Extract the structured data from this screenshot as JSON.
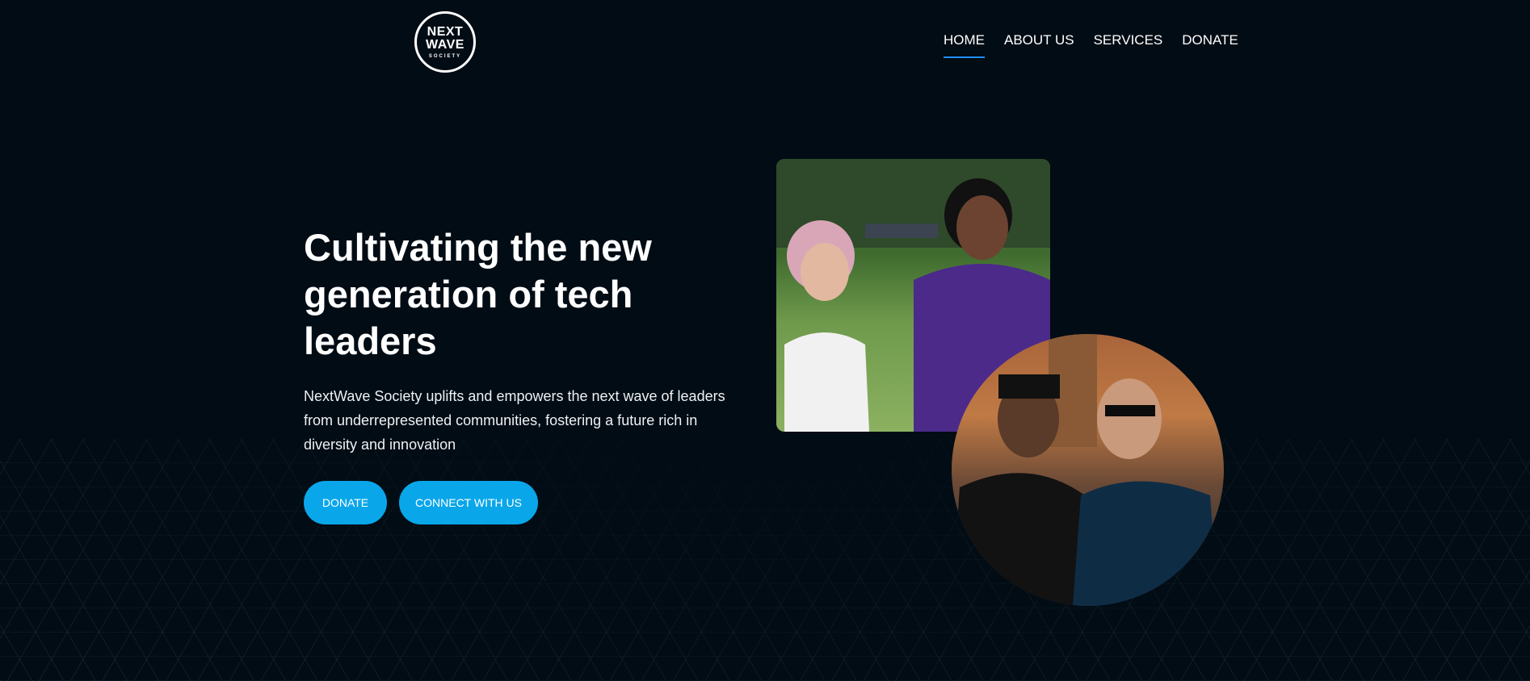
{
  "header": {
    "logo": {
      "line1": "NEXT",
      "line2": "WAVE",
      "line3": "SOCIETY"
    },
    "nav": [
      {
        "label": "HOME",
        "active": true
      },
      {
        "label": "ABOUT US",
        "active": false
      },
      {
        "label": "SERVICES",
        "active": false
      },
      {
        "label": "DONATE",
        "active": false
      }
    ]
  },
  "hero": {
    "title": "Cultivating the new generation of tech leaders",
    "text": "NextWave Society uplifts and empowers the next wave of leaders from underrepresented communities, fostering a future rich in diversity and innovation",
    "buttons": {
      "donate": "DONATE",
      "connect": "CONNECT WITH US"
    }
  },
  "colors": {
    "background": "#020c14",
    "accent": "#0aa6ea",
    "nav_underline": "#1e90ff"
  }
}
